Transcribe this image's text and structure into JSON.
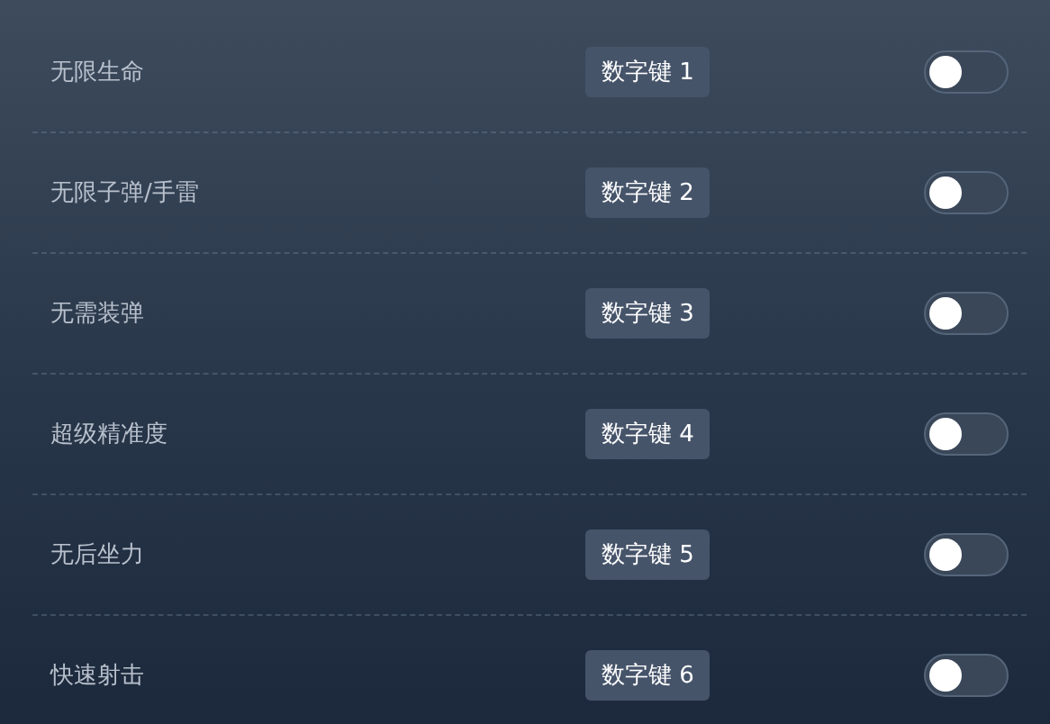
{
  "cheats": [
    {
      "name": "无限生命",
      "hotkey": "数字键 1",
      "on": false
    },
    {
      "name": "无限子弹/手雷",
      "hotkey": "数字键 2",
      "on": false
    },
    {
      "name": "无需装弹",
      "hotkey": "数字键 3",
      "on": false
    },
    {
      "name": "超级精准度",
      "hotkey": "数字键 4",
      "on": false
    },
    {
      "name": "无后坐力",
      "hotkey": "数字键 5",
      "on": false
    },
    {
      "name": "快速射击",
      "hotkey": "数字键 6",
      "on": false
    }
  ]
}
